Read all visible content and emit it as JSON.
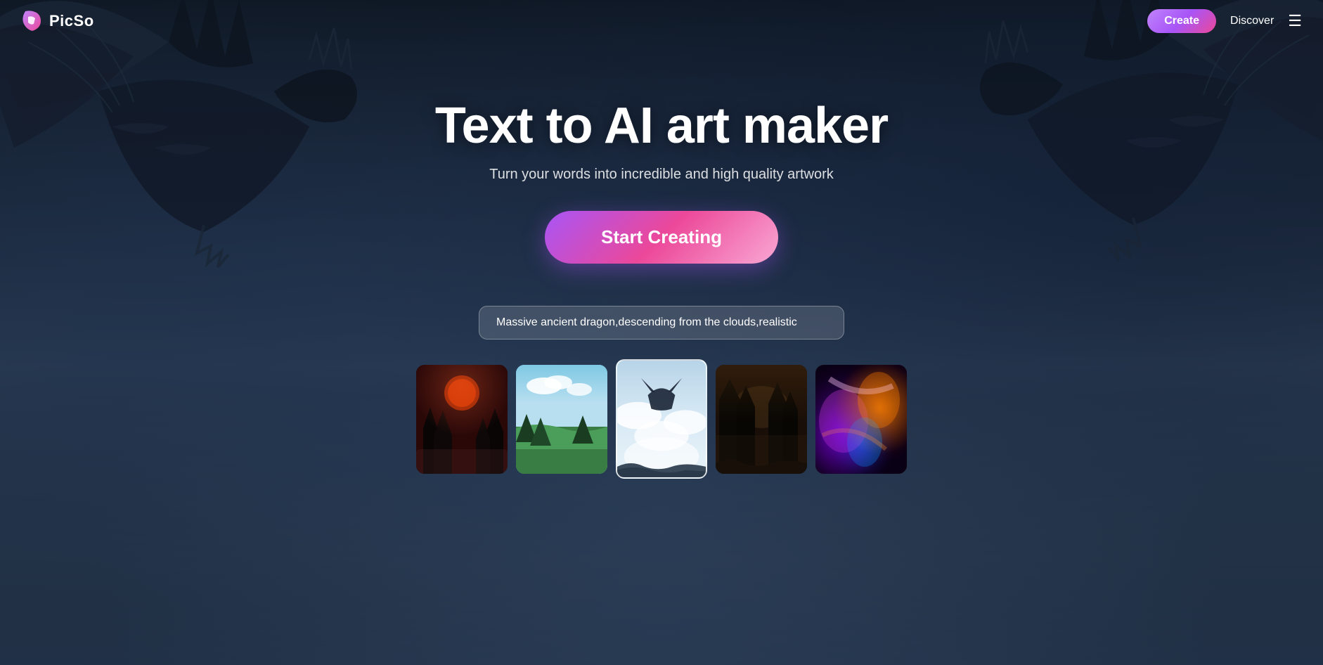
{
  "logo": {
    "name": "PicSo",
    "icon": "P"
  },
  "navbar": {
    "create_label": "Create",
    "discover_label": "Discover",
    "menu_label": "☰"
  },
  "hero": {
    "title": "Text to AI art maker",
    "subtitle": "Turn your words into incredible and high quality artwork",
    "cta_label": "Start Creating"
  },
  "prompt": {
    "value": "Massive ancient dragon,descending from the clouds,realistic",
    "placeholder": "Massive ancient dragon,descending from the clouds,realistic"
  },
  "thumbnails": [
    {
      "id": 1,
      "label": "dark forest art",
      "active": false,
      "color_class": "thumb-1"
    },
    {
      "id": 2,
      "label": "landscape art",
      "active": false,
      "color_class": "thumb-2"
    },
    {
      "id": 3,
      "label": "dragon clouds art",
      "active": true,
      "color_class": "thumb-3"
    },
    {
      "id": 4,
      "label": "dark forest scene",
      "active": false,
      "color_class": "thumb-4"
    },
    {
      "id": 5,
      "label": "colorful abstract art",
      "active": false,
      "color_class": "thumb-5"
    }
  ]
}
